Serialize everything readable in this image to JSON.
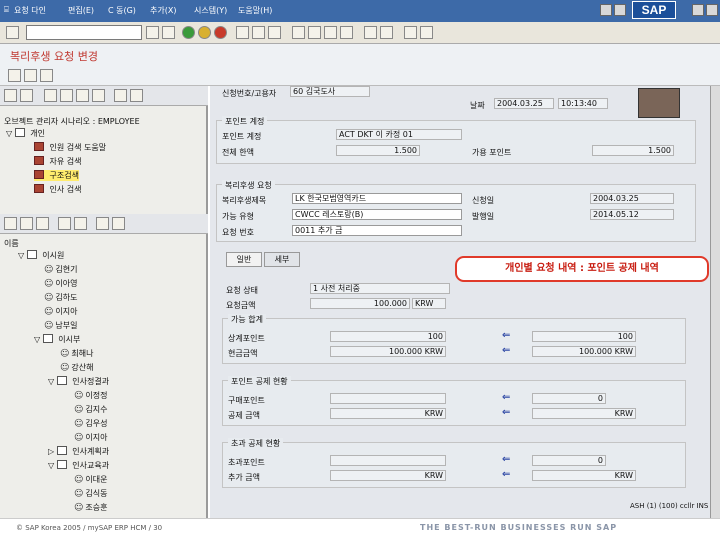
{
  "menubar": {
    "items": [
      "요청 다인",
      "편집(E)",
      "C 동(G)",
      "추가(X)",
      "시스템(Y)",
      "도움말(H)"
    ],
    "sap_logo": "SAP"
  },
  "title": "복리후생 요청 변경",
  "left_tree": {
    "header": "오브젝트 관리자 시나리오 : EMPLOYEE",
    "root": "개인",
    "items": [
      {
        "label": "인원 검색 도움말",
        "selected": false
      },
      {
        "label": "자유 검색",
        "selected": false
      },
      {
        "label": "구조검색",
        "selected": true
      },
      {
        "label": "인사 검색",
        "selected": false
      }
    ],
    "lower_header": "이름",
    "lower_root": "이시원",
    "people1": [
      "김현기",
      "이아영",
      "김하도",
      "이지아",
      "남부일"
    ],
    "sub1": "이시부",
    "sub1_people": [
      "최해나",
      "강산해"
    ],
    "sub2": "인사정결과",
    "sub2_people": [
      "이정정",
      "김지수",
      "김우성",
      "이지아"
    ],
    "sub3": "인사계획과",
    "sub4": "인사교육과",
    "sub4_people": [
      "이대운",
      "김식동",
      "조승훈"
    ]
  },
  "form": {
    "top_label": "신청번호/고용자",
    "top_value": "60 김국도사",
    "date_label": "날짜",
    "date_value": "2004.03.25",
    "time_value": "10:13:40",
    "points_box_title": "포인트 계정",
    "point_rows": [
      {
        "label": "포인트 계정",
        "value": "ACT DKT 이 카정 01"
      },
      {
        "label": "전체 한액",
        "value": "1.500",
        "label2": "가용 포인트",
        "value2": "1.500"
      }
    ],
    "request_box_title": "복리후생 요청",
    "request_rows": [
      {
        "label": "복리후생제목",
        "value": "LK 한국모범영역카드",
        "label2": "신청일",
        "value2": "2004.03.25"
      },
      {
        "label": "가능 유형",
        "value": "CWCC 레스토랑(B)",
        "label2": "발행일",
        "value2": "2014.05.12"
      },
      {
        "label": "요청 번호",
        "value": "0011 추가 금"
      }
    ],
    "tabs": [
      "일반",
      "세부"
    ],
    "request_name_label": "요청 상태",
    "request_name_value": "1 사전 처리중",
    "request_amt_label": "요청금액",
    "request_amt_value": "100.000",
    "currency": "KRW",
    "avail_box_title": "가능 합계",
    "avail_rows": [
      {
        "label": "상계포인트",
        "value": "100",
        "value2": "100"
      },
      {
        "label": "현금금액",
        "value": "100.000 KRW",
        "value2": "100.000 KRW"
      }
    ],
    "deduct_box_title": "포인트 공제 현황",
    "deduct_rows": [
      {
        "label": "구매포인트",
        "value": "",
        "value2": "0"
      },
      {
        "label": "공제 금액",
        "value": "KRW",
        "value2": "KRW"
      }
    ],
    "excess_box_title": "초과 공제 현황",
    "excess_rows": [
      {
        "label": "초과포인트",
        "value": "",
        "value2": "0"
      },
      {
        "label": "추가 금액",
        "value": "KRW",
        "value2": "KRW"
      }
    ]
  },
  "callout": "개인별 요청 내역 : 포인트 공제 내역",
  "status_bar": "ASH (1) (100) ccllr INS",
  "footer": {
    "copyright": "© SAP Korea 2005 / mySAP ERP HCM / 30",
    "slogan": "THE BEST-RUN BUSINESSES RUN SAP"
  }
}
